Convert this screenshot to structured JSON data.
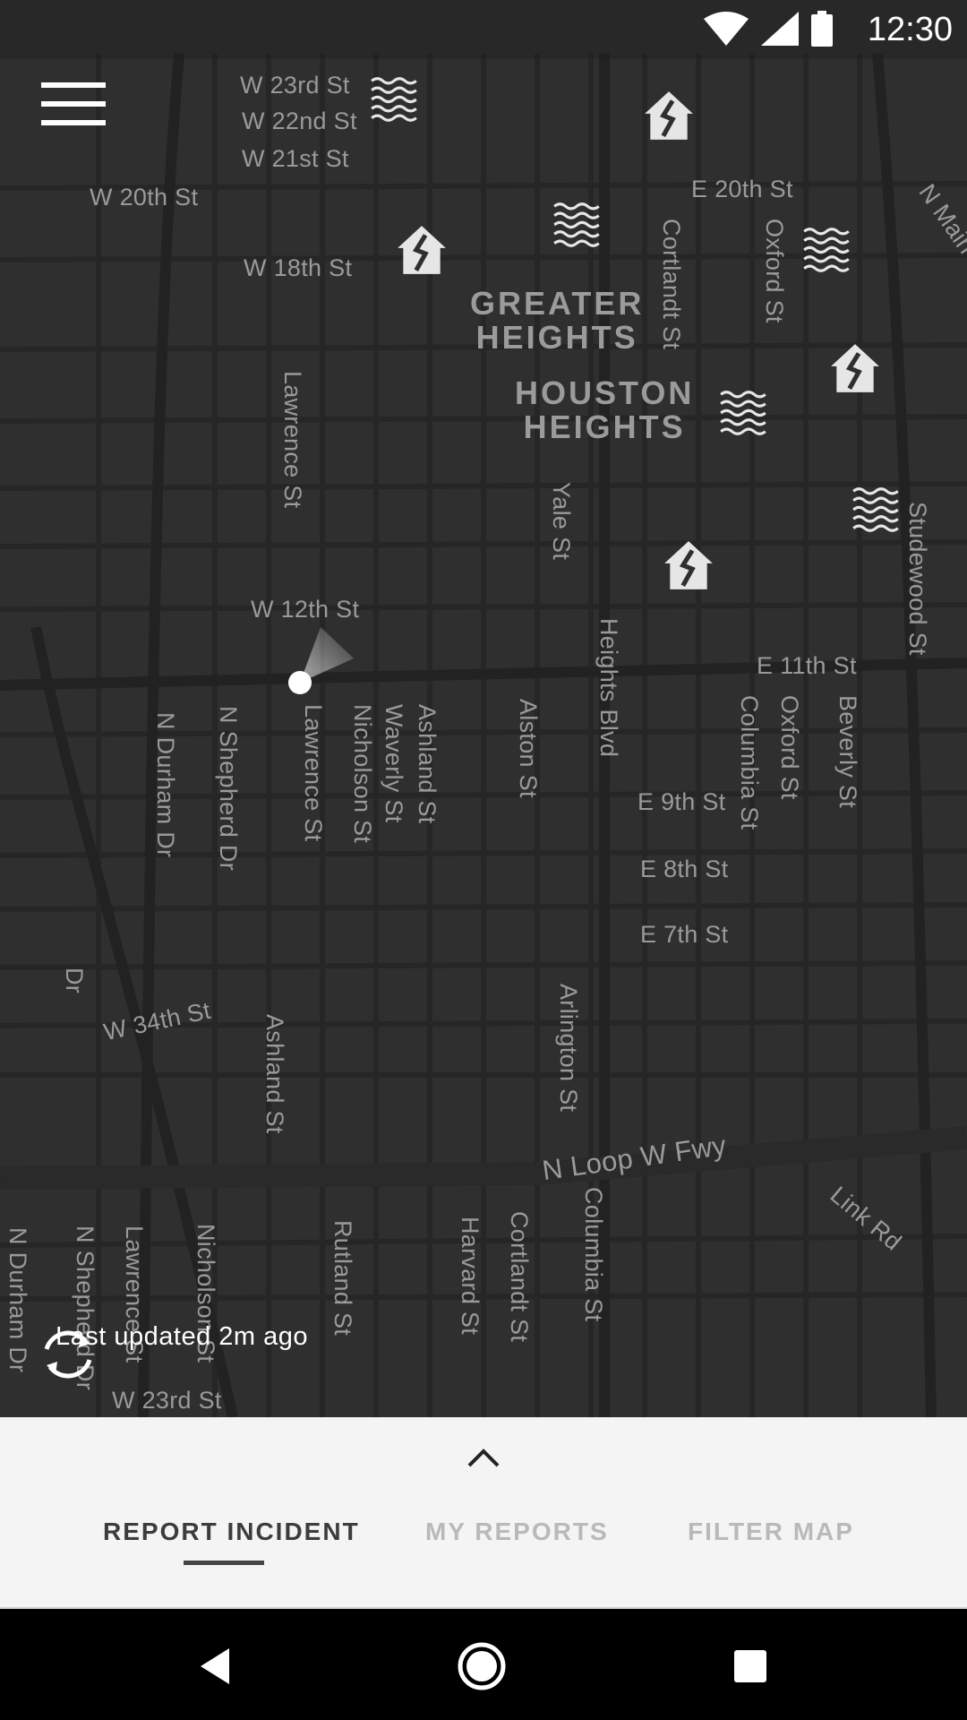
{
  "status_bar": {
    "time": "12:30"
  },
  "map": {
    "area_labels": [
      {
        "text": "GREATER\nHEIGHTS"
      },
      {
        "text": "HOUSTON\nHEIGHTS"
      }
    ],
    "streets": {
      "w23": "W 23rd St",
      "w22": "W 22nd St",
      "w21": "W 21st St",
      "w20": "W 20th St",
      "w18": "W 18th St",
      "e20": "E 20th St",
      "w12": "W 12th St",
      "e11": "E 11th St",
      "e9": "E 9th St",
      "e8": "E 8th St",
      "e7": "E 7th St",
      "w34": "W 34th St",
      "nloop": "N Loop W Fwy",
      "link": "Link Rd",
      "w23b": "W 23rd St",
      "lawrence1": "Lawrence St",
      "lawrence2": "Lawrence St",
      "lawrence3": "Lawrence St",
      "nicholson": "Nicholson St",
      "nicholson2": "Nicholson St",
      "waverly": "Waverly St",
      "ashland": "Ashland St",
      "ashland2": "Ashland St",
      "alston": "Alston St",
      "heights": "Heights Blvd",
      "yale": "Yale St",
      "cortlandt": "Cortlandt St",
      "cortlandt2": "Cortlandt St",
      "oxford": "Oxford St",
      "oxford2": "Oxford St",
      "columbia": "Columbia St",
      "columbia2": "Columbia St",
      "beverly": "Beverly St",
      "studewood": "Studewood St",
      "nmain": "N Main St",
      "ndurham": "N Durham Dr",
      "ndurham2": "N Durham Dr",
      "nshepherd": "N Shepherd Dr",
      "nshepherd2": "N Shepherd Dr",
      "arlington": "Arlington St",
      "harvard": "Harvard St",
      "rutland": "Rutland St",
      "dr": "Dr"
    }
  },
  "menu": {
    "icon": "menu-icon"
  },
  "refresh": {
    "text": "Last updated 2m ago",
    "icon": "refresh-icon"
  },
  "bottom_sheet": {
    "handle_icon": "chevron-up-icon",
    "tabs": [
      {
        "label": "REPORT INCIDENT",
        "active": true
      },
      {
        "label": "MY REPORTS",
        "active": false
      },
      {
        "label": "FILTER MAP",
        "active": false
      }
    ]
  },
  "markers": {
    "flood_icon": "flood-icon",
    "damage_icon": "house-damage-icon"
  },
  "colors": {
    "map_bg": "#2f2f2f",
    "sheet_bg": "#f4f4f4",
    "active_tab": "#3c3c3c",
    "inactive_tab": "#b9b9b9"
  }
}
